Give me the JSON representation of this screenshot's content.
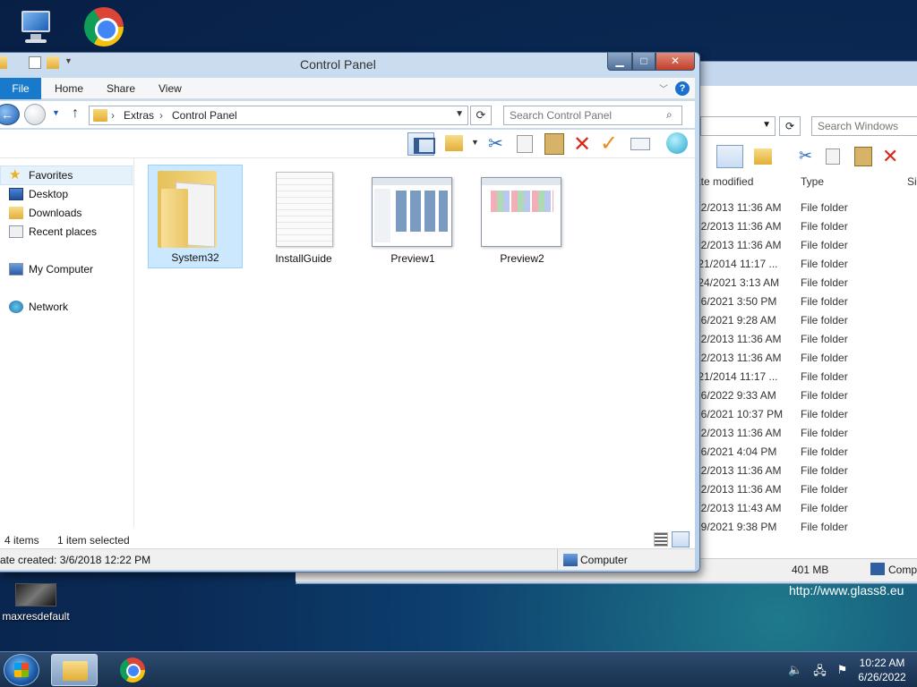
{
  "desktop": {
    "icons": [
      {
        "label": ""
      },
      {
        "label": ""
      },
      {
        "label": "maxresdefault"
      }
    ],
    "watermark": "http://www.glass8.eu"
  },
  "back_window": {
    "search_placeholder": "Search Windows",
    "columns": [
      "ate modified",
      "Type",
      "Si"
    ],
    "rows": [
      {
        "date": "22/2013 11:36 AM",
        "type": "File folder"
      },
      {
        "date": "22/2013 11:36 AM",
        "type": "File folder"
      },
      {
        "date": "22/2013 11:36 AM",
        "type": "File folder"
      },
      {
        "date": "/21/2014 11:17 ...",
        "type": "File folder"
      },
      {
        "date": "/24/2021 3:13 AM",
        "type": "File folder"
      },
      {
        "date": "26/2021 3:50 PM",
        "type": "File folder"
      },
      {
        "date": "26/2021 9:28 AM",
        "type": "File folder"
      },
      {
        "date": "22/2013 11:36 AM",
        "type": "File folder"
      },
      {
        "date": "22/2013 11:36 AM",
        "type": "File folder"
      },
      {
        "date": "/21/2014 11:17 ...",
        "type": "File folder"
      },
      {
        "date": "26/2022 9:33 AM",
        "type": "File folder"
      },
      {
        "date": "26/2021 10:37 PM",
        "type": "File folder"
      },
      {
        "date": "22/2013 11:36 AM",
        "type": "File folder"
      },
      {
        "date": "26/2021 4:04 PM",
        "type": "File folder"
      },
      {
        "date": "22/2013 11:36 AM",
        "type": "File folder"
      },
      {
        "date": "22/2013 11:36 AM",
        "type": "File folder"
      },
      {
        "date": "22/2013 11:43 AM",
        "type": "File folder"
      },
      {
        "date": "29/2021 9:38 PM",
        "type": "File folder"
      }
    ],
    "status_size": "401 MB",
    "status_location": "Comp"
  },
  "window": {
    "title": "Control Panel",
    "minimize": "▁",
    "maximize": "□",
    "close": "✕",
    "ribbon_tabs": [
      "File",
      "Home",
      "Share",
      "View"
    ],
    "help": "?",
    "breadcrumb": [
      "Extras",
      "Control Panel"
    ],
    "search_placeholder": "Search Control Panel",
    "nav_pane": {
      "favorites": "Favorites",
      "items": [
        "Desktop",
        "Downloads",
        "Recent places"
      ],
      "computer": "My Computer",
      "network": "Network"
    },
    "files": [
      {
        "name": "System32",
        "selected": true
      },
      {
        "name": "InstallGuide",
        "selected": false
      },
      {
        "name": "Preview1",
        "selected": false
      },
      {
        "name": "Preview2",
        "selected": false
      }
    ],
    "status": {
      "count": "4 items",
      "selection": "1 item selected"
    },
    "details": {
      "created": "ate created: 3/6/2018 12:22 PM",
      "location": "Computer"
    }
  },
  "taskbar": {
    "time": "10:22 AM",
    "date": "6/26/2022"
  }
}
